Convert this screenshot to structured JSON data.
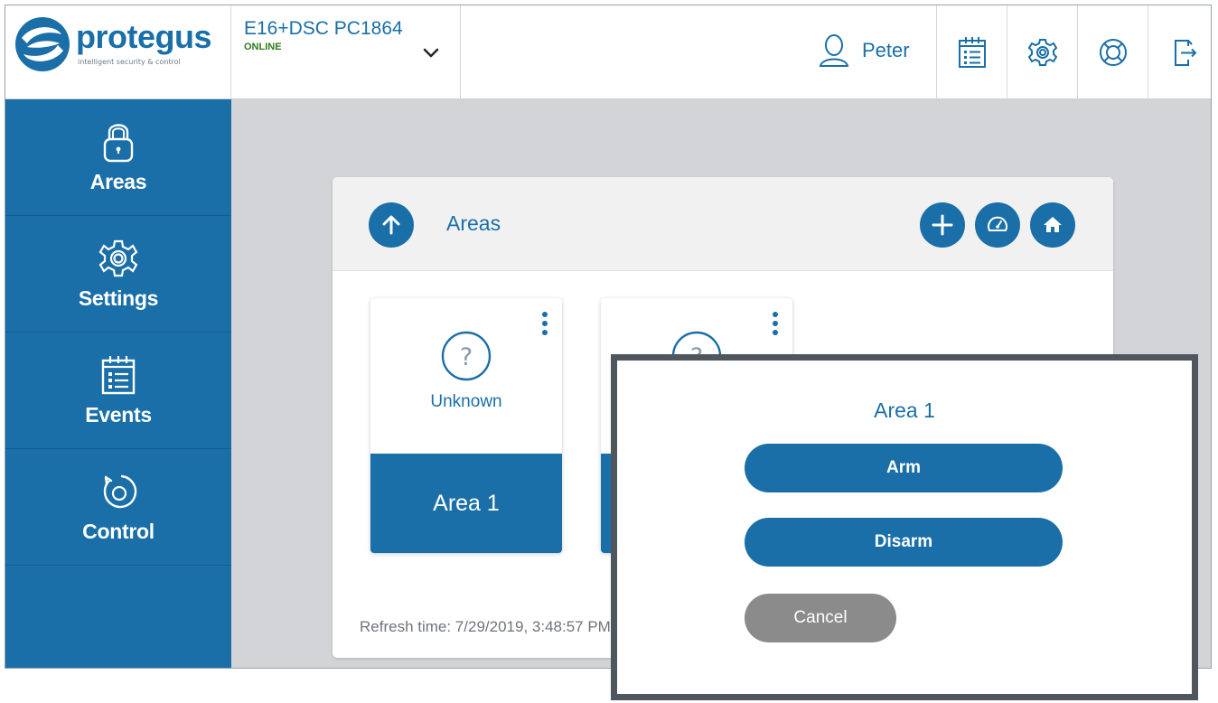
{
  "brand": {
    "name": "protegus",
    "tagline": "intelligent security & control",
    "primary_color": "#1a6fa8"
  },
  "device": {
    "name": "E16+DSC PC1864",
    "status": "ONLINE",
    "status_color": "#2f7a1b"
  },
  "user": {
    "name": "Peter"
  },
  "header_buttons": [
    {
      "icon": "calendar-list-icon"
    },
    {
      "icon": "gear-icon"
    },
    {
      "icon": "lifebuoy-icon"
    },
    {
      "icon": "logout-icon"
    }
  ],
  "sidebar": {
    "items": [
      {
        "label": "Areas",
        "icon": "padlock-icon"
      },
      {
        "label": "Settings",
        "icon": "gear-icon"
      },
      {
        "label": "Events",
        "icon": "calendar-list-icon"
      },
      {
        "label": "Control",
        "icon": "rotate-circle-icon"
      }
    ]
  },
  "main": {
    "title": "Areas",
    "tiles": [
      {
        "state": "Unknown",
        "name": "Area 1"
      },
      {
        "state": "",
        "name": ""
      }
    ],
    "refresh_text": "Refresh time: 7/29/2019, 3:48:57 PM"
  },
  "modal": {
    "title": "Area 1",
    "arm_label": "Arm",
    "disarm_label": "Disarm",
    "cancel_label": "Cancel"
  }
}
